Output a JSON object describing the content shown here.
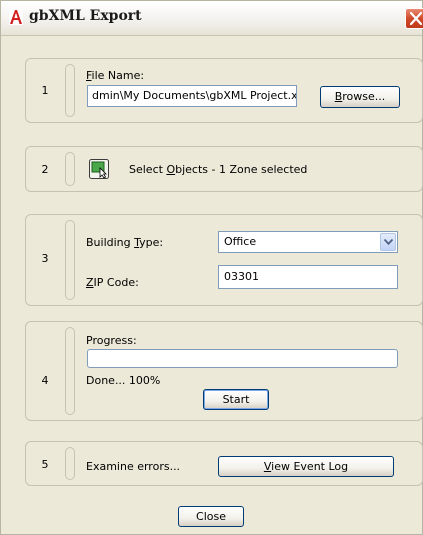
{
  "window": {
    "title": "gbXML Export",
    "icons": {
      "app": "autocad-a-icon",
      "close": "close-x-icon"
    }
  },
  "step1": {
    "number": "1",
    "file_label": "File Name:",
    "file_label_mnemonic": "F",
    "file_value": "dmin\\My Documents\\gbXML Project.xml",
    "browse_label": "Browse...",
    "browse_mnemonic": "B"
  },
  "step2": {
    "number": "2",
    "select_text": "Select Objects - 1 Zone selected",
    "select_mnemonic": "O",
    "icon": "select-objects-icon"
  },
  "step3": {
    "number": "3",
    "building_type_label": "Building Type:",
    "building_type_mnemonic": "T",
    "building_type_value": "Office",
    "zip_label": "ZIP Code:",
    "zip_mnemonic": "Z",
    "zip_value": "03301"
  },
  "step4": {
    "number": "4",
    "progress_label": "Progress:",
    "progress_fraction": 0,
    "done_text": "Done... 100%",
    "start_label": "Start"
  },
  "step5": {
    "number": "5",
    "examine_text": "Examine errors...",
    "view_log_label": "View Event Log",
    "view_log_mnemonic": "V"
  },
  "footer": {
    "close_label": "Close"
  }
}
